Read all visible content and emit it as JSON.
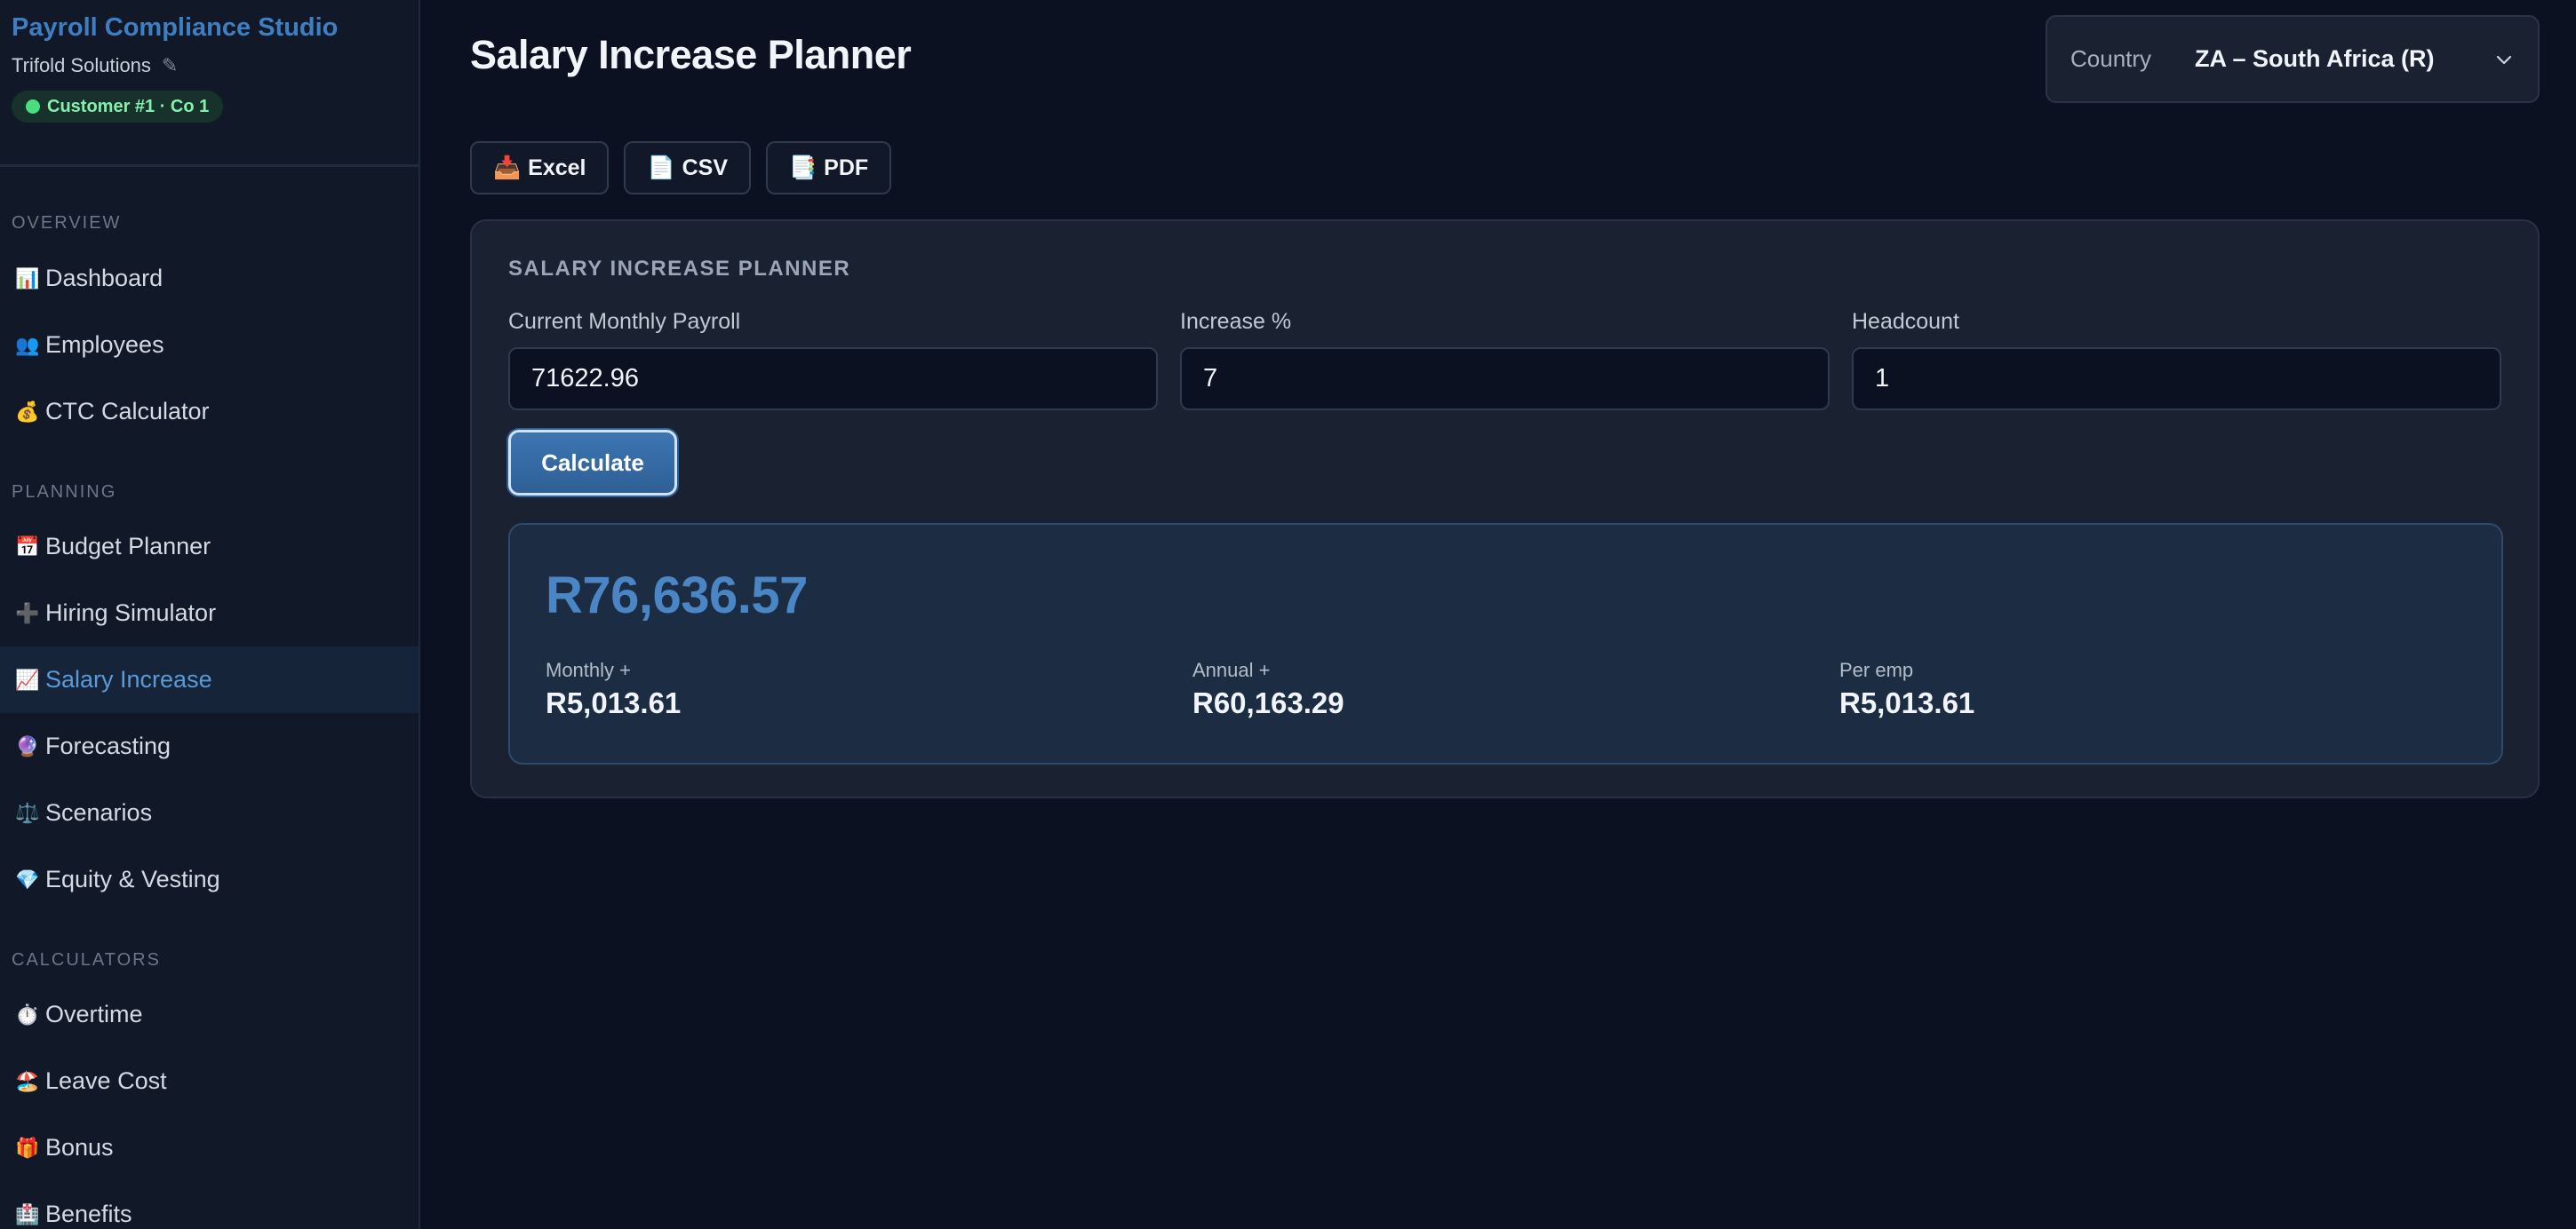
{
  "sidebar": {
    "app_name": "Payroll Compliance Studio",
    "org_name": "Trifold Solutions",
    "edit_icon_glyph": "✎",
    "customer_badge": "Customer #1 · Co 1",
    "sections": {
      "overview": "OVERVIEW",
      "planning": "PLANNING",
      "calculators": "CALCULATORS"
    },
    "items": {
      "dashboard": {
        "icon": "📊",
        "label": "Dashboard"
      },
      "employees": {
        "icon": "👥",
        "label": "Employees"
      },
      "ctc_calculator": {
        "icon": "💰",
        "label": "CTC Calculator"
      },
      "budget_planner": {
        "icon": "📅",
        "label": "Budget Planner"
      },
      "hiring_simulator": {
        "icon": "➕",
        "label": "Hiring Simulator"
      },
      "salary_increase": {
        "icon": "📈",
        "label": "Salary Increase"
      },
      "forecasting": {
        "icon": "🔮",
        "label": "Forecasting"
      },
      "scenarios": {
        "icon": "⚖️",
        "label": "Scenarios"
      },
      "equity_vesting": {
        "icon": "💎",
        "label": "Equity & Vesting"
      },
      "overtime": {
        "icon": "⏱️",
        "label": "Overtime"
      },
      "leave_cost": {
        "icon": "🏖️",
        "label": "Leave Cost"
      },
      "bonus": {
        "icon": "🎁",
        "label": "Bonus"
      },
      "benefits": {
        "icon": "🏥",
        "label": "Benefits"
      }
    },
    "active_item": "salary_increase"
  },
  "header": {
    "title": "Salary Increase Planner",
    "country_label": "Country",
    "country_value": "ZA – South Africa (R)"
  },
  "exports": {
    "excel": {
      "icon": "📥",
      "label": "Excel"
    },
    "csv": {
      "icon": "📄",
      "label": "CSV"
    },
    "pdf": {
      "icon": "📑",
      "label": "PDF"
    }
  },
  "planner": {
    "section_title": "SALARY INCREASE PLANNER",
    "fields": {
      "current_payroll": {
        "label": "Current Monthly Payroll",
        "value": "71622.96"
      },
      "increase_pct": {
        "label": "Increase %",
        "value": "7"
      },
      "headcount": {
        "label": "Headcount",
        "value": "1"
      }
    },
    "calculate_label": "Calculate",
    "result": {
      "total": "R76,636.57",
      "monthly": {
        "label": "Monthly +",
        "value": "R5,013.61"
      },
      "annual": {
        "label": "Annual +",
        "value": "R60,163.29"
      },
      "per_emp": {
        "label": "Per emp",
        "value": "R5,013.61"
      }
    }
  },
  "colors": {
    "accent": "#3f7fc1",
    "background": "#0b1120",
    "sidebar": "#111827",
    "badge_green": "#4ade80"
  }
}
